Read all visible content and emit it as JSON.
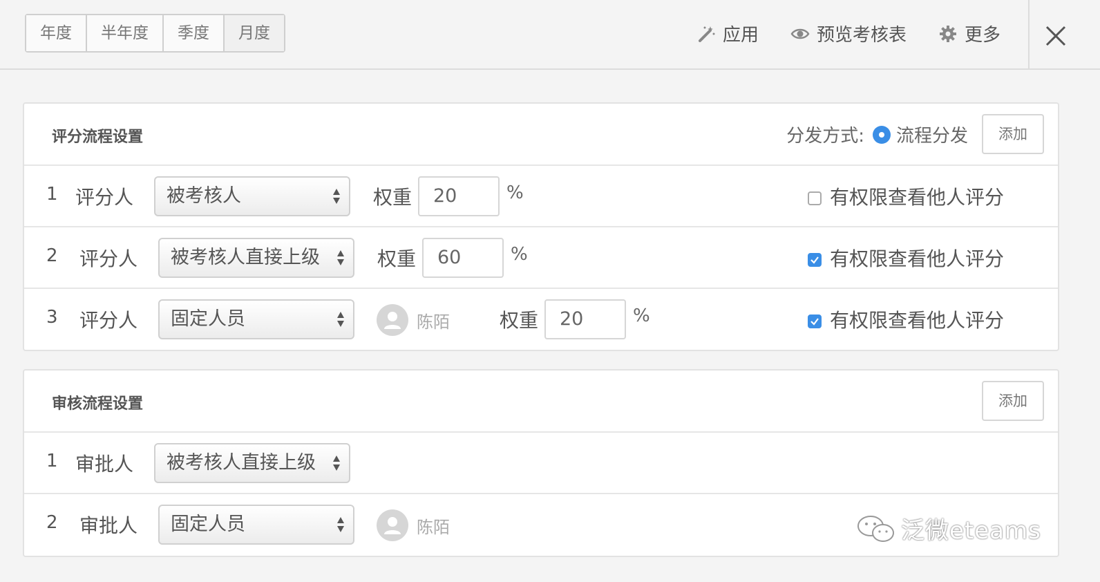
{
  "period_tabs": [
    "年度",
    "半年度",
    "季度",
    "月度"
  ],
  "actions": {
    "apply": "应用",
    "preview": "预览考核表",
    "more": "更多"
  },
  "icons": {
    "apply": "magic-wand-icon",
    "preview": "eye-icon",
    "more": "gear-icon",
    "close": "close-icon"
  },
  "scoring": {
    "title": "评分流程设置",
    "distribution_label": "分发方式:",
    "distribution_value": "流程分发",
    "add_label": "添加",
    "weight_label": "权重",
    "percent": "%",
    "rows": [
      {
        "index": "1",
        "role": "评分人",
        "select": "被考核人",
        "weight": "20",
        "perm": "有权限查看他人评分",
        "checked": false
      },
      {
        "index": "2",
        "role": "评分人",
        "select": "被考核人直接上级",
        "weight": "60",
        "perm": "有权限查看他人评分",
        "checked": true
      },
      {
        "index": "3",
        "role": "评分人",
        "select": "固定人员",
        "person": "陈陌",
        "weight": "20",
        "perm": "有权限查看他人评分",
        "checked": true
      }
    ]
  },
  "review": {
    "title": "审核流程设置",
    "add_label": "添加",
    "rows": [
      {
        "index": "1",
        "role": "审批人",
        "select": "被考核人直接上级"
      },
      {
        "index": "2",
        "role": "审批人",
        "select": "固定人员",
        "person": "陈陌"
      }
    ]
  },
  "watermark": "泛微eteams",
  "colors": {
    "accent": "#3a8ee6",
    "background": "#f4f4f4"
  }
}
